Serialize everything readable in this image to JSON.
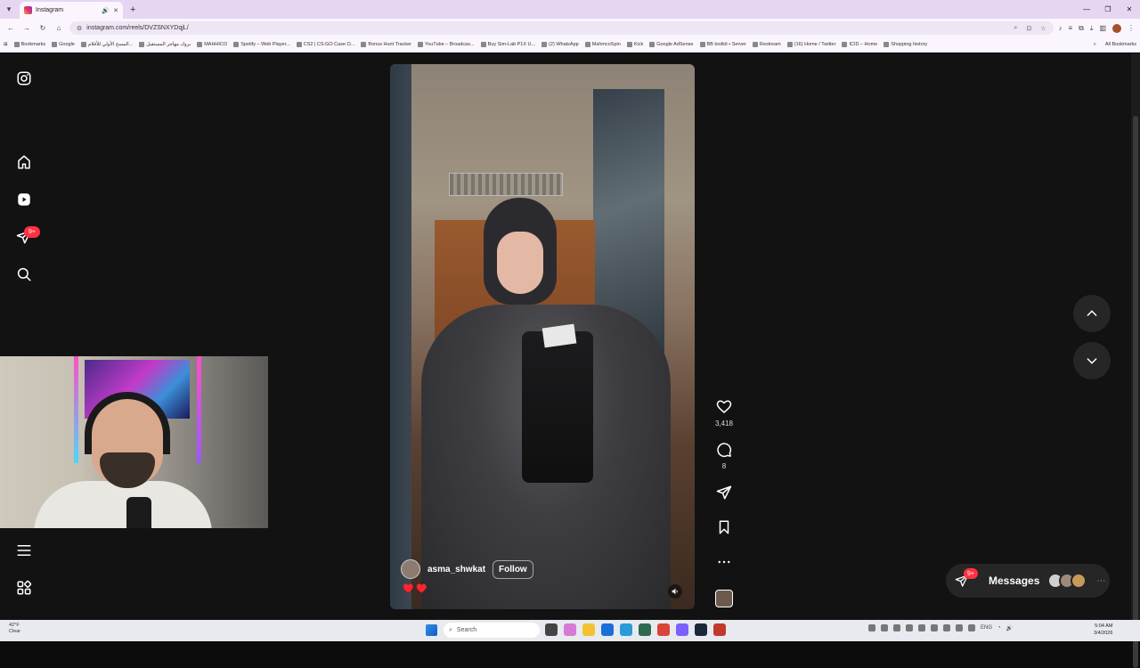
{
  "browser": {
    "tab_title": "Instagram",
    "url": "instagram.com/reels/DVZSNXYDqjL/",
    "bookmarks": [
      "Bookmarks",
      "Google",
      "المسح الأولي للأفلام...",
      "بروك مهاجر المستقبل",
      "MAHHICO",
      "Spotify – Web Player...",
      "CS2 | CS:GO Case O...",
      "Bonus Hunt Tracker",
      "YouTube – Broadcas...",
      "Buy Sim-Lab P1X U...",
      "(2) WhatsApp",
      "MahmcoSpin",
      "Kick",
      "Google AdSense",
      "BB toolkit • Server",
      "Restream",
      "(16) Home / Twitter",
      "ICID – Home",
      "Shopping history"
    ],
    "all_bookmarks": "All Bookmarks"
  },
  "sidebar": {
    "notifications_badge": "9+"
  },
  "reel": {
    "username": "asma_shwkat",
    "follow_label": "Follow",
    "caption": "♥️ ♥️",
    "likes": "3,418",
    "comments": "8"
  },
  "messages": {
    "label": "Messages",
    "badge": "9+"
  },
  "taskbar": {
    "weather_temp": "42°F",
    "weather_desc": "Clear",
    "search_placeholder": "Search",
    "lang": "ENG",
    "time": "5:04 AM",
    "date": "3/4/2026"
  },
  "colors": {
    "background": "#121212",
    "badge_red": "#ff3040",
    "accent_tabstrip": "#e6d6f2"
  },
  "icons": [
    "instagram-logo-icon",
    "home-icon",
    "reels-icon",
    "direct-icon",
    "search-icon",
    "menu-icon",
    "meta-apps-icon",
    "heart-icon",
    "comment-icon",
    "share-icon",
    "bookmark-icon",
    "more-icon",
    "chevron-up-icon",
    "chevron-down-icon",
    "mute-icon"
  ]
}
